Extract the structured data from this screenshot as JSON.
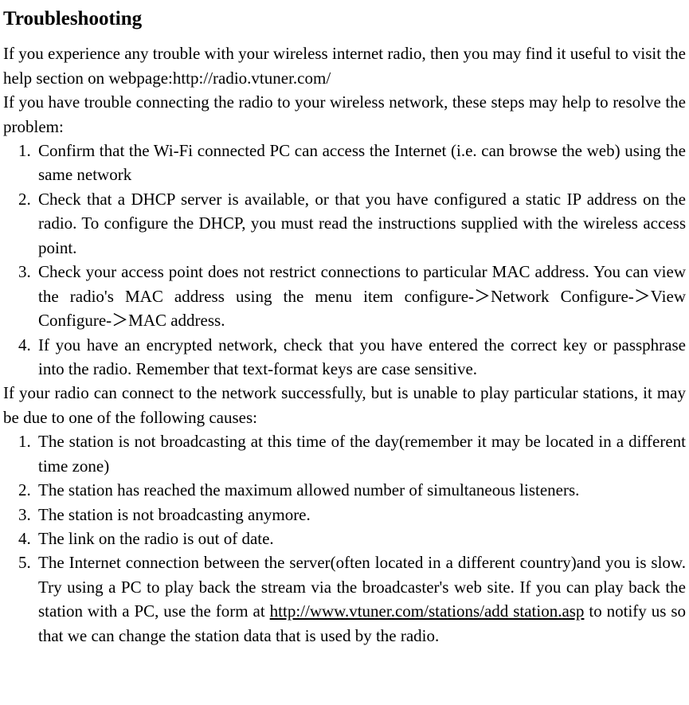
{
  "title": "Troubleshooting",
  "intro1": "If you experience any trouble with your wireless internet radio, then you may find it useful to visit the help section on webpage:http://radio.vtuner.com/",
  "intro2": "If you have trouble connecting the radio to your wireless network, these steps may help to resolve the problem:",
  "list1": {
    "item1": "Confirm that the Wi-Fi connected PC can access the Internet (i.e. can browse the web) using the same network",
    "item2": "Check that a DHCP server is available, or that you have configured a static IP address on the radio. To configure the DHCP, you must read the instructions supplied with the wireless access point.",
    "item3": "Check your access point does not restrict connections to particular MAC address. You can view the radio's MAC address using the menu item configure-＞Network Configure-＞View Configure-＞MAC address.",
    "item4": "If you have an encrypted network, check that you have entered the correct key or passphrase into the radio. Remember that text-format keys are case sensitive."
  },
  "intro3": "If your radio can connect to the network successfully, but is unable to play particular stations, it may be due to one of the following causes:",
  "list2": {
    "item1": "The station is not broadcasting at this time of the day(remember it may be located in a different time zone)",
    "item2": "The station has reached the maximum allowed number of simultaneous listeners.",
    "item3": "The station is not broadcasting anymore.",
    "item4": "The link on the radio is out of date.",
    "item5_pre": "The Internet connection between the server(often located in a different country)and you is slow. Try using a PC to play back the stream via the broadcaster's web site. If you can play back the station with a PC, use the form at ",
    "item5_link": "http://www.vtuner.com/stations/add station.asp",
    "item5_post": " to notify us so that we can change the station data that is used by the radio."
  }
}
